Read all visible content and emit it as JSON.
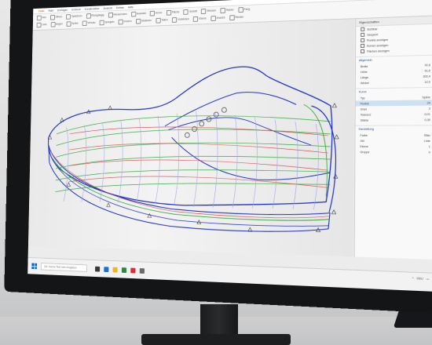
{
  "app": {
    "title_tabs": [
      "Datei",
      "Start",
      "Einfügen",
      "Entwurf",
      "Konstruktion",
      "Ansicht",
      "Extras",
      "Hilfe"
    ],
    "active_tab_index": 0
  },
  "ribbon": {
    "row1": [
      "Neu",
      "Öffnen",
      "Speichern",
      "Rückgängig",
      "Wiederholen",
      "Auswahl",
      "Kurve",
      "Fläche",
      "Schnitt",
      "Messen",
      "Raster",
      "Fang"
    ],
    "row2": [
      "Linie",
      "Bogen",
      "Spline",
      "Versatz",
      "Spiegeln",
      "Drehen",
      "Skalieren",
      "Teilen",
      "Verbinden",
      "Ebene",
      "Ansicht",
      "Render"
    ]
  },
  "viewport": {
    "background": "#efefef",
    "curve_colors": {
      "outline": "#1d2fc4",
      "green": "#2fa83a",
      "red": "#d23a3a",
      "pale": "#9aa3e6"
    }
  },
  "panel": {
    "header": "Eigenschaften",
    "checks": [
      "Sichtbar",
      "Gesperrt",
      "Punkte anzeigen",
      "Kurven anzeigen",
      "Flächen anzeigen"
    ],
    "section1": "Allgemein",
    "rows1": [
      [
        "Breite",
        "92,8"
      ],
      [
        "Höhe",
        "51,6"
      ],
      [
        "Länge",
        "302,4"
      ],
      [
        "Winkel",
        "12,0"
      ]
    ],
    "section2": "Kurve",
    "rows2": [
      [
        "Typ",
        "Spline"
      ],
      [
        "Punkte",
        "24"
      ],
      [
        "Grad",
        "3"
      ],
      [
        "Toleranz",
        "0,01"
      ],
      [
        "Stärke",
        "0,35"
      ]
    ],
    "selected_row_index": 1,
    "section3": "Darstellung",
    "rows3": [
      [
        "Farbe",
        "Blau"
      ],
      [
        "Stil",
        "Linie"
      ],
      [
        "Ebene",
        "1"
      ],
      [
        "Gruppe",
        "0"
      ]
    ]
  },
  "taskbar": {
    "search_placeholder": "Zur Suche Text hier eingeben",
    "app_colors": [
      "#3a3a3a",
      "#1f6fd1",
      "#f0b429",
      "#2a8a3e",
      "#d13438",
      "#6b6b6b"
    ],
    "tray_text": "DEU"
  }
}
